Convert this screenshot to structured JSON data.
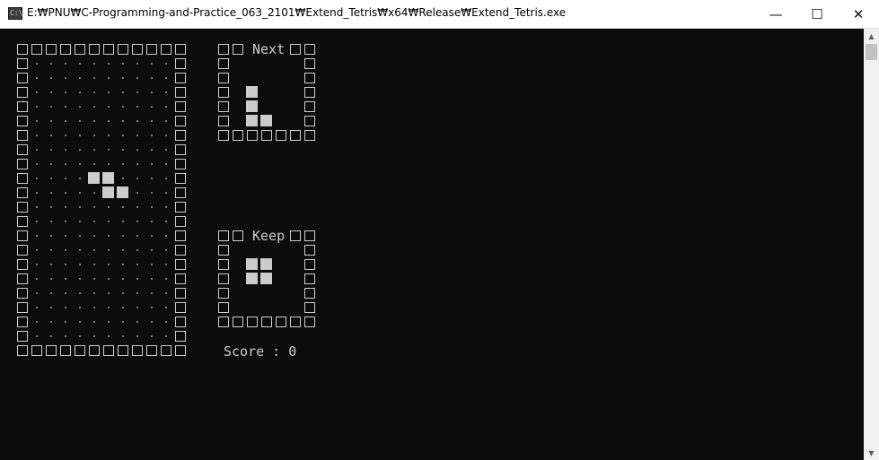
{
  "window": {
    "title": "E:₩PNU₩C-Programming-and-Practice_063_2101₩Extend_Tetris₩x64₩Release₩Extend_Tetris.exe",
    "app_icon_text": "C:\\",
    "controls": {
      "minimize": "—",
      "maximize": "☐",
      "close": "✕"
    }
  },
  "game": {
    "board": {
      "cols": 12,
      "rows": 22,
      "active_piece": [
        [
          5,
          9
        ],
        [
          6,
          9
        ],
        [
          6,
          10
        ],
        [
          7,
          10
        ]
      ]
    },
    "next_panel": {
      "label": "Next",
      "piece": [
        [
          2,
          3
        ],
        [
          2,
          4
        ],
        [
          2,
          5
        ],
        [
          3,
          5
        ]
      ]
    },
    "keep_panel": {
      "label": "Keep",
      "piece": [
        [
          2,
          2
        ],
        [
          3,
          2
        ],
        [
          2,
          3
        ],
        [
          3,
          3
        ]
      ]
    },
    "score_text": "Score : 0"
  },
  "colors": {
    "background": "#0c0c0c",
    "foreground": "#cccccc"
  },
  "icons": {
    "scroll_up": "triangle-up",
    "scroll_down": "triangle-down"
  }
}
